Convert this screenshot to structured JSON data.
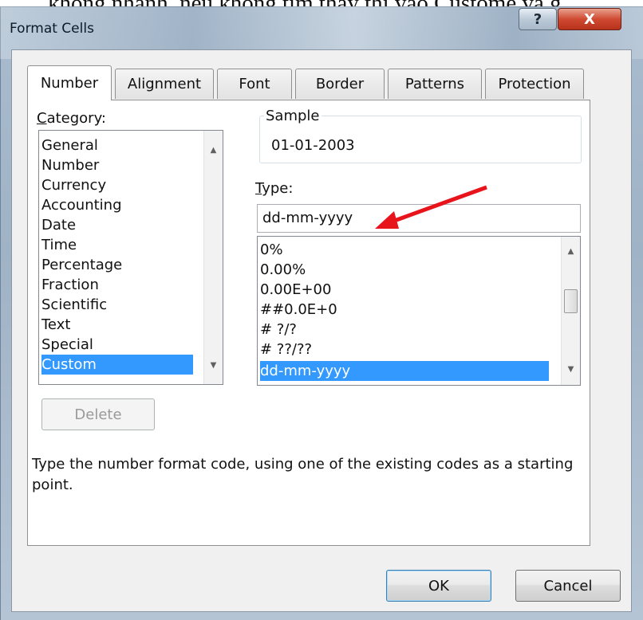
{
  "doc_snippet": "không nhanh, nếu không tìm thấy thì vào Custome và g",
  "window": {
    "title": "Format Cells",
    "help_glyph": "?",
    "close_glyph": "X"
  },
  "tabs": [
    "Number",
    "Alignment",
    "Font",
    "Border",
    "Patterns",
    "Protection"
  ],
  "category": {
    "label_underlined": "C",
    "label_rest": "ategory:",
    "items": [
      "General",
      "Number",
      "Currency",
      "Accounting",
      "Date",
      "Time",
      "Percentage",
      "Fraction",
      "Scientific",
      "Text",
      "Special",
      "Custom"
    ],
    "selected": "Custom"
  },
  "sample": {
    "legend": "Sample",
    "value": "01-01-2003"
  },
  "type": {
    "label_underlined": "T",
    "label_rest": "ype:",
    "value": "dd-mm-yyyy",
    "list": [
      "0%",
      "0.00%",
      "0.00E+00",
      "##0.0E+0",
      "# ?/?",
      "# ??/??",
      "dd-mm-yyyy"
    ],
    "selected": "dd-mm-yyyy"
  },
  "buttons": {
    "delete": "Delete",
    "ok": "OK",
    "cancel": "Cancel"
  },
  "description": "Type the number format code, using one of the existing codes as a starting point.",
  "annotation": {
    "color": "#e8141c"
  }
}
